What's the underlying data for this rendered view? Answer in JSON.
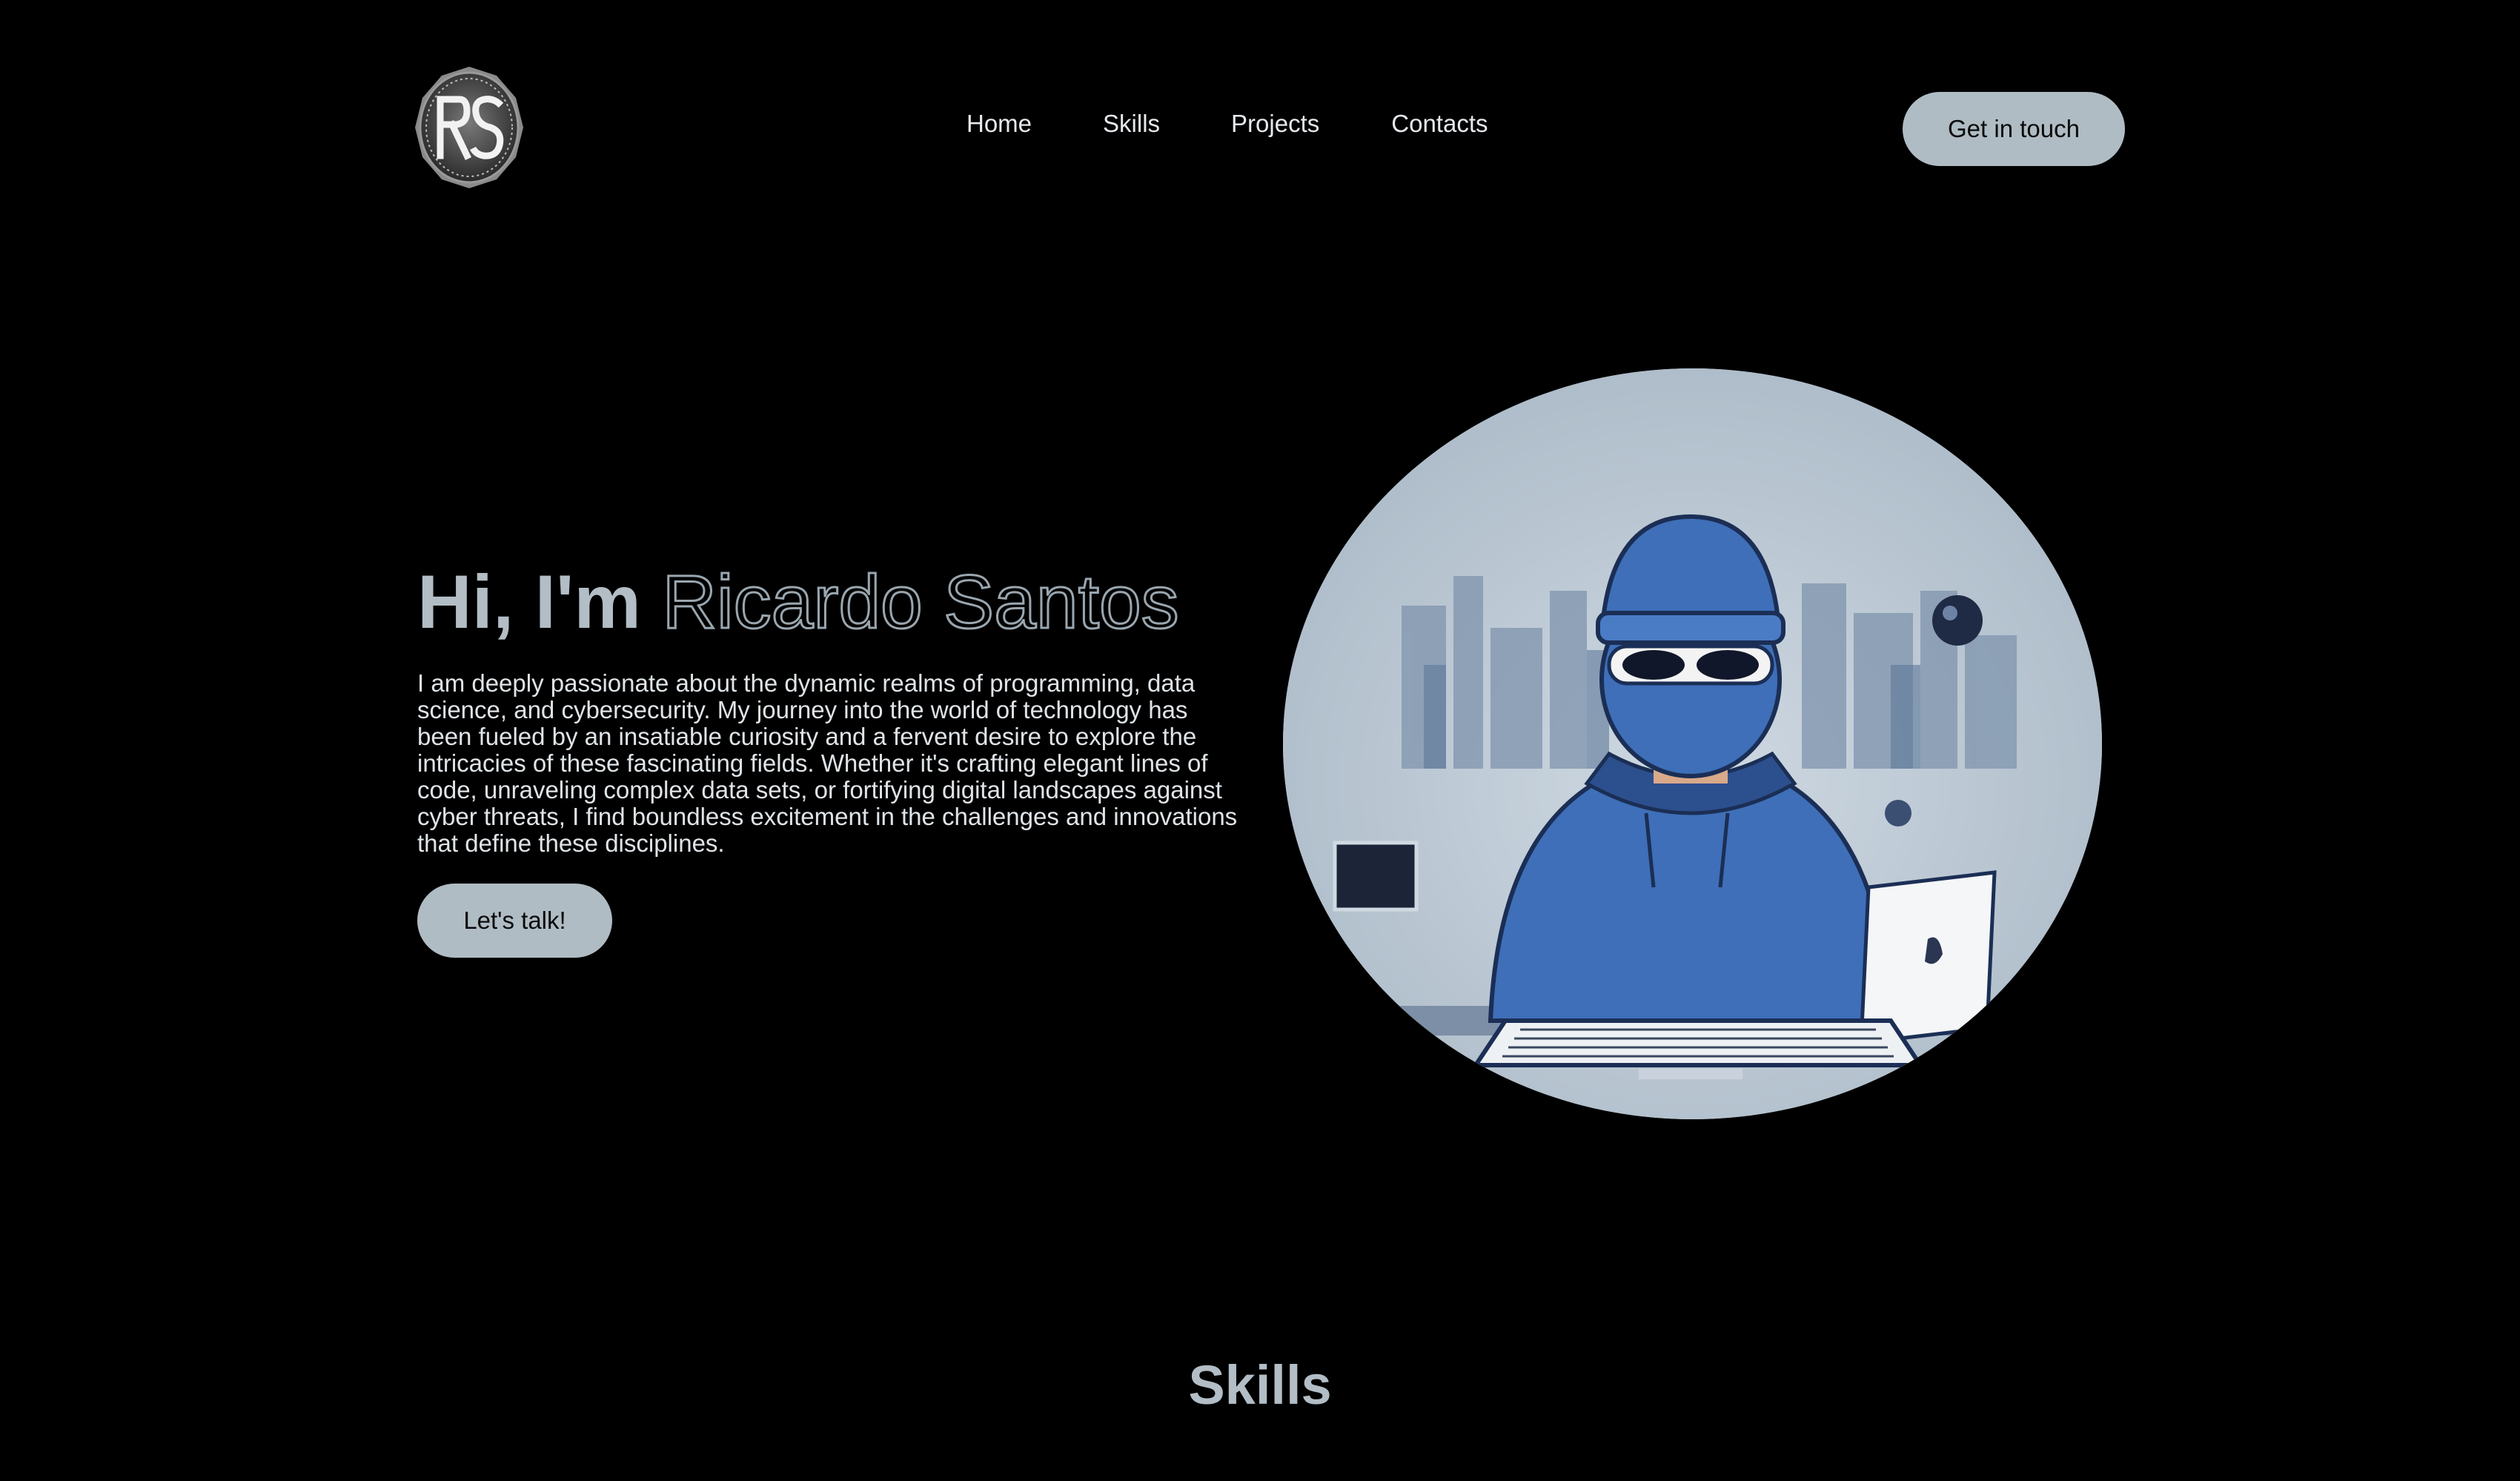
{
  "logo": {
    "text": "RS",
    "icon": "rs-monogram-logo"
  },
  "nav": {
    "items": [
      {
        "label": "Home"
      },
      {
        "label": "Skills"
      },
      {
        "label": "Projects"
      },
      {
        "label": "Contacts"
      }
    ]
  },
  "header": {
    "cta_label": "Get in touch"
  },
  "hero": {
    "greeting": "Hi, I'm",
    "name": "Ricardo Santos",
    "description": "I am deeply passionate about the dynamic realms of programming, data science, and cybersecurity. My journey into the world of technology has been fueled by an insatiable curiosity and a fervent desire to explore the intricacies of these fascinating fields. Whether it's crafting elegant lines of code, unraveling complex data sets, or fortifying digital landscapes against cyber threats, I find boundless excitement in the challenges and innovations that define these disciplines.",
    "cta_label": "Let's talk!",
    "image": "hacker-illustration"
  },
  "skills": {
    "title": "Skills"
  },
  "colors": {
    "background": "#000000",
    "accent": "#b0bcc4",
    "heading": "#b2bdc5",
    "hoodie": "#3e6fb8"
  }
}
